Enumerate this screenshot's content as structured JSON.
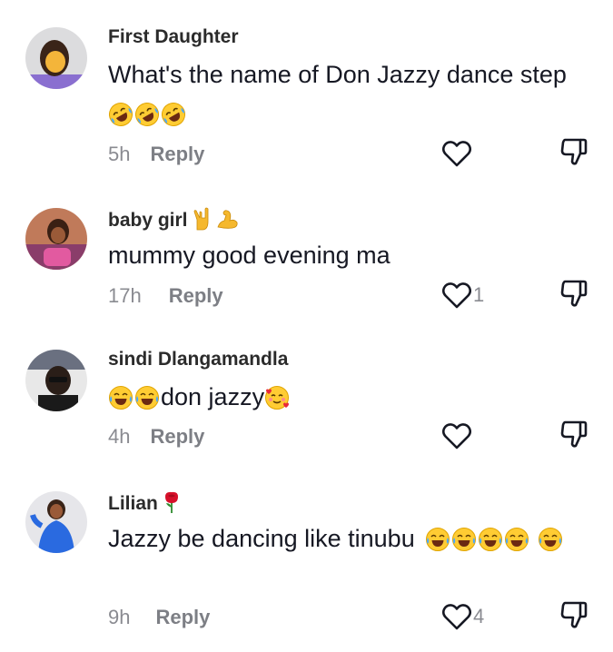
{
  "comments": [
    {
      "username": "First Daughter",
      "text": "What's the name of Don Jazzy dance step",
      "text_emojis": [
        "rofl-emoji",
        "rofl-emoji",
        "rofl-emoji"
      ],
      "time": "5h",
      "reply_label": "Reply",
      "likes": ""
    },
    {
      "username": "baby girl",
      "username_emojis": [
        "rock-hand-emoji",
        "flexed-biceps-emoji"
      ],
      "text": "mummy good evening ma",
      "time": "17h",
      "reply_label": "Reply",
      "likes": "1"
    },
    {
      "username": "sindi Dlangamandla",
      "text_prefix_emojis": [
        "joy-emoji",
        "joy-emoji"
      ],
      "text": "don jazzy",
      "text_emojis": [
        "smiling-face-with-hearts-emoji"
      ],
      "time": "4h",
      "reply_label": "Reply",
      "likes": ""
    },
    {
      "username": "Lilian",
      "username_emojis": [
        "rose-emoji"
      ],
      "text": "Jazzy be dancing like tinubu",
      "text_emojis": [
        "joy-emoji",
        "joy-emoji",
        "joy-emoji",
        "joy-emoji",
        "joy-emoji"
      ],
      "time": "9h",
      "reply_label": "Reply",
      "likes": "4"
    }
  ],
  "colors": {
    "text": "#161823",
    "username": "#2b2b2b",
    "meta": "#8a8b91"
  },
  "icons": {
    "like": "heart-outline-icon",
    "dislike": "thumbs-down-outline-icon"
  }
}
